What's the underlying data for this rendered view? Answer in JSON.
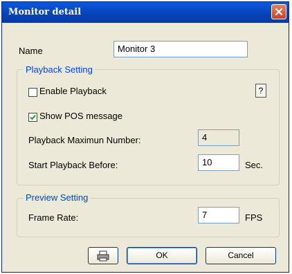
{
  "window": {
    "title": "Monitor detail",
    "close_icon": "close-x-icon"
  },
  "name_field": {
    "label": "Name",
    "value": "Monitor 3"
  },
  "playback_setting": {
    "title": "Playback Setting",
    "help_label": "?",
    "enable_playback": {
      "label": "Enable Playback",
      "checked": false
    },
    "show_pos_message": {
      "label": "Show POS message",
      "checked": true
    },
    "max_number": {
      "label": "Playback Maximun Number:",
      "value": "4"
    },
    "start_before": {
      "label": "Start Playback Before:",
      "value": "10",
      "unit": "Sec."
    }
  },
  "preview_setting": {
    "title": "Preview Setting",
    "frame_rate": {
      "label": "Frame Rate:",
      "value": "7",
      "unit": "FPS"
    }
  },
  "buttons": {
    "print_icon": "printer-icon",
    "ok": "OK",
    "cancel": "Cancel"
  },
  "colors": {
    "titlebar": "#0842b8",
    "dialog_bg": "#ece9d8",
    "group_title": "#0046d5",
    "close_button": "#d9573c"
  }
}
